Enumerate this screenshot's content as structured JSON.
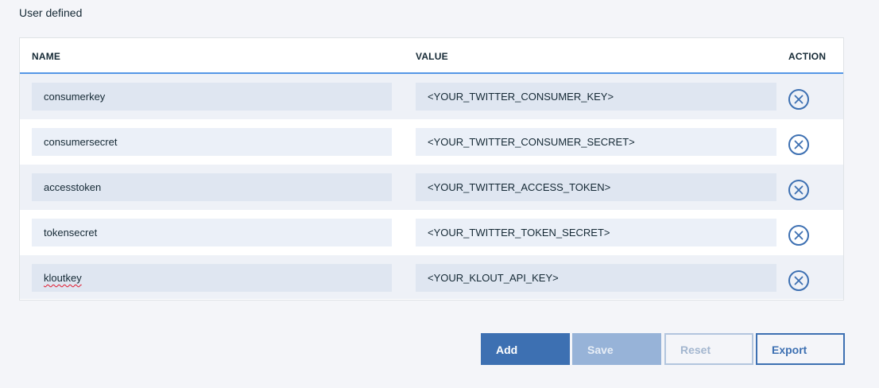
{
  "section": {
    "title": "User defined"
  },
  "table": {
    "headers": {
      "name": "NAME",
      "value": "VALUE",
      "action": "ACTION"
    },
    "rows": [
      {
        "name": "consumerkey",
        "value": "<YOUR_TWITTER_CONSUMER_KEY>"
      },
      {
        "name": "consumersecret",
        "value": "<YOUR_TWITTER_CONSUMER_SECRET>"
      },
      {
        "name": "accesstoken",
        "value": "<YOUR_TWITTER_ACCESS_TOKEN>"
      },
      {
        "name": "tokensecret",
        "value": "<YOUR_TWITTER_TOKEN_SECRET>"
      },
      {
        "name": "kloutkey",
        "value": "<YOUR_KLOUT_API_KEY>"
      }
    ],
    "row_action_icon": "close-circle-icon"
  },
  "buttons": {
    "add": "Add",
    "save": "Save",
    "reset": "Reset",
    "export": "Export"
  },
  "colors": {
    "primary": "#3d70b2",
    "header_rule": "#5596e6",
    "disabled_primary": "#97b3d8",
    "spellcheck": "#e0182d"
  }
}
